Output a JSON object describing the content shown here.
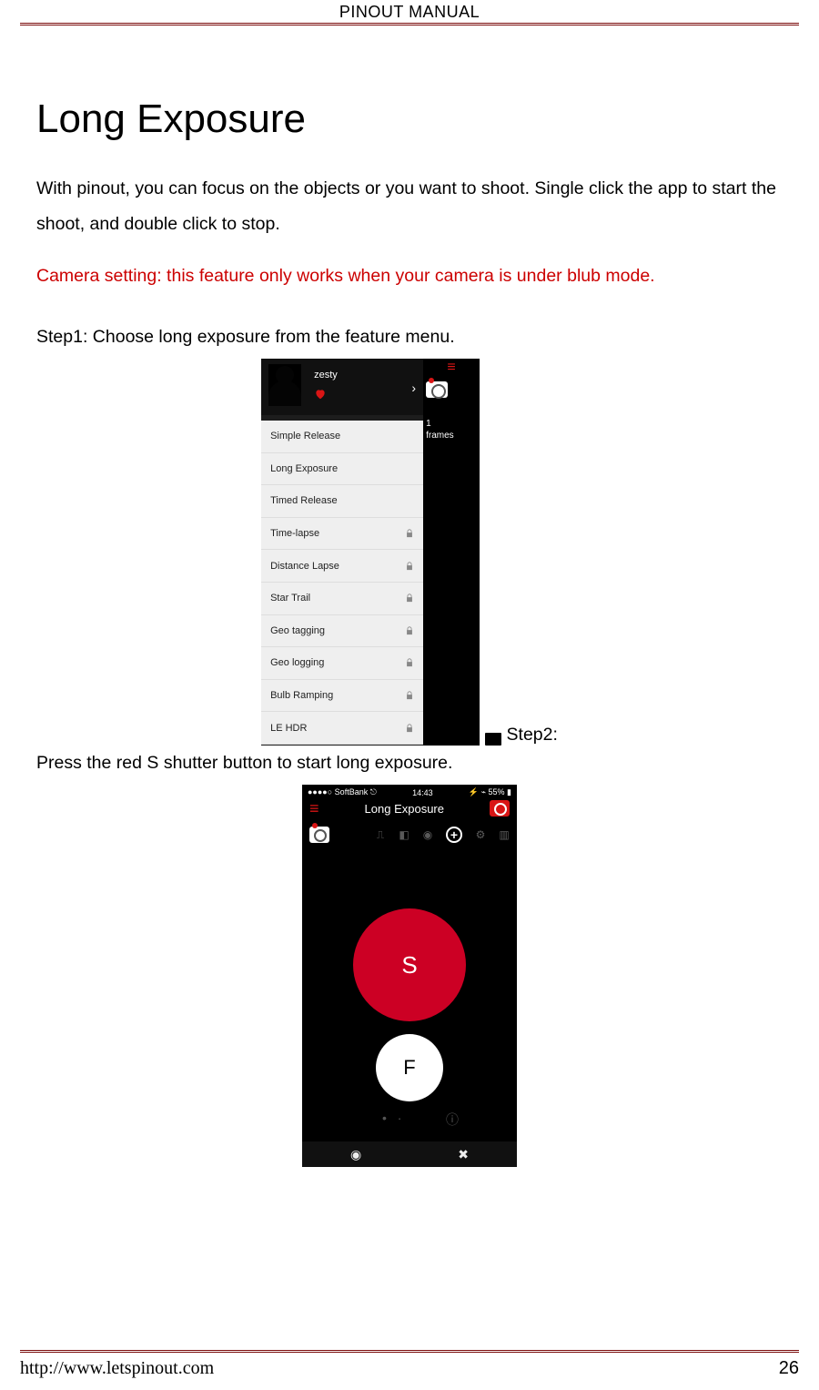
{
  "header": {
    "title": "PINOUT MANUAL"
  },
  "main": {
    "title": "Long Exposure",
    "intro": "With pinout, you can focus on the objects or you want to shoot. Single click the app to start the shoot, and double click to stop.",
    "notice": "Camera setting: this feature only works when your camera is under blub mode.",
    "step1": "Step1: Choose long exposure from the feature menu.",
    "step2_label": "Step2:",
    "step2_rest": "Press the red S shutter button to start long exposure."
  },
  "scr1": {
    "profile_name": "zesty",
    "frames_num": "1",
    "frames_label": "frames",
    "menu": [
      {
        "label": "Simple Release",
        "locked": false
      },
      {
        "label": "Long Exposure",
        "locked": false
      },
      {
        "label": "Timed Release",
        "locked": false
      },
      {
        "label": "Time-lapse",
        "locked": true
      },
      {
        "label": "Distance Lapse",
        "locked": true
      },
      {
        "label": "Star Trail",
        "locked": true
      },
      {
        "label": "Geo tagging",
        "locked": true
      },
      {
        "label": "Geo logging",
        "locked": true
      },
      {
        "label": "Bulb Ramping",
        "locked": true
      },
      {
        "label": "LE HDR",
        "locked": true
      }
    ]
  },
  "scr2": {
    "status_left": "●●●●○ SoftBank ⎋",
    "status_time": "14:43",
    "status_right": "⚡ ⌁ 55% ▮",
    "title": "Long Exposure",
    "shutter": "S",
    "focus": "F"
  },
  "footer": {
    "url": "http://www.letspinout.com",
    "page": "26"
  }
}
